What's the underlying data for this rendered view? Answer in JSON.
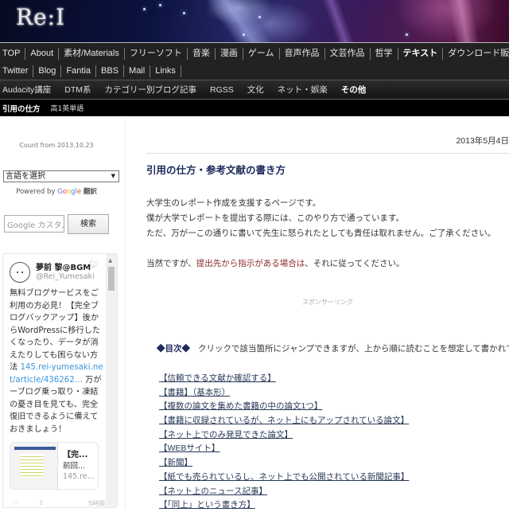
{
  "site": {
    "logo": "Re:I"
  },
  "nav_primary": {
    "row1": [
      "TOP",
      "About",
      "素材/Materials",
      "フリーソフト",
      "音楽",
      "漫画",
      "ゲーム",
      "音声作品",
      "文芸作品",
      "哲学",
      "テキスト",
      "ダウンロード販売"
    ],
    "row2": [
      "Twitter",
      "Blog",
      "Fantia",
      "BBS",
      "Mail",
      "Links"
    ],
    "active": "テキスト"
  },
  "nav_secondary": {
    "items": [
      "Audacity講座",
      "DTM系",
      "カテゴリー別ブログ記事",
      "RGSS",
      "文化",
      "ネット・娯楽",
      "その他"
    ],
    "active": "その他"
  },
  "nav_tertiary": {
    "items": [
      "引用の仕方",
      "高1英単語"
    ],
    "active": "引用の仕方"
  },
  "sidebar": {
    "count_text": "Count from 2013.10.23",
    "language_select": {
      "value": "言語を選択",
      "arrow": "▼"
    },
    "powered_by": {
      "prefix": "Powered by",
      "google": [
        "G",
        "o",
        "o",
        "g",
        "l",
        "e"
      ],
      "suffix": "翻訳"
    },
    "search": {
      "placeholder": "Google カスタム検索",
      "button": "検索"
    },
    "twitter": {
      "name": "夢前 黎@BGM",
      "handle": "@Rei_Yumesaki",
      "bird_icon": "twitter-bird-icon",
      "tweet_text": "無料ブログサービスをご利用の方必見！【完全ブログバックアップ】後からWordPressに移行したくなったり、データが消えたりしても困らない方法 ",
      "tweet_link": "145.rei-yumesaki.net/article/436262…",
      "tweet_text2": " 万がーブログ乗っ取り・凍結の憂き目を見ても、完全復旧できるように備えておきましょう！",
      "card": {
        "title": "【完...",
        "desc": "前回...",
        "url": "145.re..."
      },
      "time": "5時間",
      "scroll_up": "▲"
    }
  },
  "article": {
    "date": "2013年5月4日",
    "title": "引用の仕方・参考文献の書き方",
    "paragraphs": [
      "大学生のレポート作成を支援するページです。",
      "僕が大学でレポートを提出する際には、このやり方で通っています。",
      "ただ、万が一この通りに書いて先生に怒られたとしても責任は取れません。ご了承ください。"
    ],
    "notice_prefix": "当然ですが、",
    "notice_warn": "提出先から指示がある場合は",
    "notice_suffix": "、それに従ってください。",
    "sponsor": "スポンサーリンク",
    "toc_label": "◆目次◆",
    "toc_intro": "クリックで該当箇所にジャンプできますが、上から順に読むことを想定して書かれています。",
    "toc": [
      "【信頼できる文献か確認する】",
      "【書籍】（基本形）",
      "【複数の論文を集めた書籍の中の論文1つ】",
      "【書籍に収録されているが、ネット上にもアップされている論文】",
      "【ネット上でのみ発見できた論文】",
      "【WEBサイト】",
      "【新聞】",
      "【紙でも売られているし、ネット上でも公開されている新聞記事】",
      "【ネット上のニュース記事】",
      "【「同上」という書き方】"
    ]
  }
}
